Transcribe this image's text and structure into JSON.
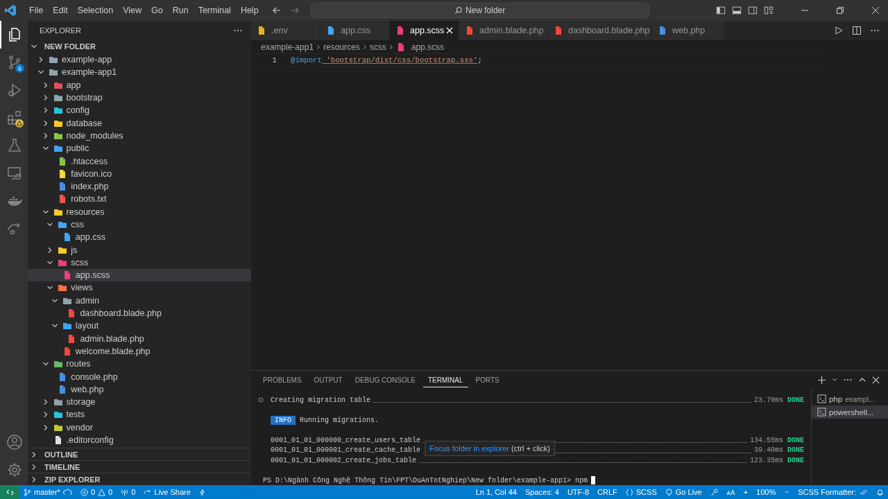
{
  "title_bar": {
    "menu": [
      "File",
      "Edit",
      "Selection",
      "View",
      "Go",
      "Run",
      "Terminal",
      "Help"
    ],
    "command_center": {
      "title": "New folder"
    }
  },
  "activity_bar": {
    "items": [
      {
        "kind": "explorer",
        "selected": true
      },
      {
        "kind": "source-control",
        "selected": false,
        "badge": "6"
      },
      {
        "kind": "run-debug",
        "selected": false
      },
      {
        "kind": "extensions",
        "selected": false,
        "warning": true
      },
      {
        "kind": "testing",
        "selected": false
      },
      {
        "kind": "remote",
        "selected": false
      },
      {
        "kind": "docker",
        "selected": false
      },
      {
        "kind": "live-share",
        "selected": false
      }
    ]
  },
  "sidebar": {
    "title": "EXPLORER",
    "root": "NEW FOLDER",
    "tree": [
      {
        "name": "example-app",
        "kind": "folder",
        "expanded": false,
        "selected": false,
        "color": "#90a4ae"
      },
      {
        "name": "example-app1",
        "kind": "folder",
        "expanded": true,
        "selected": false,
        "color": "#90a4ae",
        "children": [
          {
            "name": "app",
            "kind": "folder",
            "expanded": false,
            "selected": false,
            "color": "#e0505a"
          },
          {
            "name": "bootstrap",
            "kind": "folder",
            "expanded": false,
            "selected": false,
            "color": "#90a4ae"
          },
          {
            "name": "config",
            "kind": "folder",
            "expanded": false,
            "selected": false,
            "color": "#26c6da"
          },
          {
            "name": "database",
            "kind": "folder",
            "expanded": false,
            "selected": false,
            "color": "#ffca28"
          },
          {
            "name": "node_modules",
            "kind": "folder",
            "expanded": false,
            "selected": false,
            "color": "#8bc34a"
          },
          {
            "name": "public",
            "kind": "folder",
            "expanded": true,
            "selected": false,
            "color": "#42a5f5",
            "children": [
              {
                "name": ".htaccess",
                "kind": "file",
                "selected": false,
                "color": "#8bc34a"
              },
              {
                "name": "favicon.ico",
                "kind": "file",
                "selected": false,
                "color": "#ffd740"
              },
              {
                "name": "index.php",
                "kind": "file",
                "selected": false,
                "color": "#4a8fe0"
              },
              {
                "name": "robots.txt",
                "kind": "file",
                "selected": false,
                "color": "#ef5350"
              }
            ]
          },
          {
            "name": "resources",
            "kind": "folder",
            "expanded": true,
            "selected": false,
            "color": "#ffca28",
            "children": [
              {
                "name": "css",
                "kind": "folder",
                "expanded": true,
                "selected": false,
                "color": "#42a5f5",
                "children": [
                  {
                    "name": "app.css",
                    "kind": "file",
                    "selected": false,
                    "color": "#42a5f5"
                  }
                ]
              },
              {
                "name": "js",
                "kind": "folder",
                "expanded": false,
                "selected": false,
                "color": "#ffca28"
              },
              {
                "name": "scss",
                "kind": "folder",
                "expanded": true,
                "selected": false,
                "color": "#ec407a",
                "children": [
                  {
                    "name": "app.scss",
                    "kind": "file",
                    "selected": true,
                    "color": "#ec407a"
                  }
                ]
              },
              {
                "name": "views",
                "kind": "folder",
                "expanded": true,
                "selected": false,
                "color": "#ff7043",
                "children": [
                  {
                    "name": "admin",
                    "kind": "folder",
                    "expanded": true,
                    "selected": false,
                    "color": "#90a4ae",
                    "children": [
                      {
                        "name": "dashboard.blade.php",
                        "kind": "file",
                        "selected": false,
                        "color": "#f4473d"
                      }
                    ]
                  },
                  {
                    "name": "layout",
                    "kind": "folder",
                    "expanded": true,
                    "selected": false,
                    "color": "#42a5f5",
                    "children": [
                      {
                        "name": "admin.blade.php",
                        "kind": "file",
                        "selected": false,
                        "color": "#f4473d"
                      }
                    ]
                  },
                  {
                    "name": "welcome.blade.php",
                    "kind": "file",
                    "selected": false,
                    "color": "#f4473d"
                  }
                ]
              }
            ]
          },
          {
            "name": "routes",
            "kind": "folder",
            "expanded": true,
            "selected": false,
            "color": "#66bb6a",
            "children": [
              {
                "name": "console.php",
                "kind": "file",
                "selected": false,
                "color": "#4a8fe0"
              },
              {
                "name": "web.php",
                "kind": "file",
                "selected": false,
                "color": "#4a8fe0"
              }
            ]
          },
          {
            "name": "storage",
            "kind": "folder",
            "expanded": false,
            "selected": false,
            "color": "#90a4ae"
          },
          {
            "name": "tests",
            "kind": "folder",
            "expanded": false,
            "selected": false,
            "color": "#26c6da"
          },
          {
            "name": "vendor",
            "kind": "folder",
            "expanded": false,
            "selected": false,
            "color": "#c0ca33"
          },
          {
            "name": ".editorconfig",
            "kind": "file",
            "selected": false,
            "color": "#e0e0e0"
          }
        ]
      }
    ],
    "sections": [
      "OUTLINE",
      "TIMELINE",
      "ZIP EXPLORER"
    ]
  },
  "tabs": [
    {
      "label": ".env",
      "selected": false,
      "color": "#e6b422"
    },
    {
      "label": "app.css",
      "selected": false,
      "color": "#42a5f5"
    },
    {
      "label": "app.scss",
      "selected": true,
      "color": "#ec407a"
    },
    {
      "label": "admin.blade.php",
      "selected": false,
      "color": "#f4473d"
    },
    {
      "label": "dashboard.blade.php",
      "selected": false,
      "color": "#f4473d"
    },
    {
      "label": "web.php",
      "selected": false,
      "color": "#4a8fe0"
    }
  ],
  "breadcrumb": [
    "example-app1",
    "resources",
    "scss",
    "app.scss"
  ],
  "code": [
    {
      "line_number": "1",
      "tokens": [
        {
          "kind": "keyword",
          "text": "@import"
        },
        {
          "kind": "string",
          "text": " 'bootstrap/dist/css/bootstrap.sss'"
        },
        {
          "kind": "punctuation",
          "text": ";"
        }
      ]
    }
  ],
  "panel": {
    "tabs": [
      {
        "label": "PROBLEMS",
        "selected": false
      },
      {
        "label": "OUTPUT",
        "selected": false
      },
      {
        "label": "DEBUG CONSOLE",
        "selected": false
      },
      {
        "label": "TERMINAL",
        "selected": true
      },
      {
        "label": "PORTS",
        "selected": false
      }
    ],
    "terminal": [
      {
        "kind": "task",
        "text": "Creating migration table",
        "time": "23.70ms",
        "status": "DONE"
      },
      {
        "kind": "info",
        "badge": "INFO",
        "text": "Running migrations."
      },
      {
        "kind": "task",
        "text": "0001_01_01_000000_create_users_table",
        "time": "134.55ms",
        "status": "DONE"
      },
      {
        "kind": "task",
        "text": "0001_01_01_000001_create_cache_table",
        "time": "39.40ms",
        "status": "DONE"
      },
      {
        "kind": "task",
        "text": "0001_01_01_000002_create_jobs_table",
        "time": "123.35ms",
        "status": "DONE"
      },
      {
        "kind": "prompt",
        "text": "PS D:\\Ngành Công Nghệ Thông Tin\\FPT\\DuAnTotNghiep\\New folder\\example-app1> npm"
      }
    ],
    "tooltip": {
      "link": "Focus folder in explorer",
      "hint": "(ctrl + click)"
    },
    "terminals": [
      {
        "name": "php",
        "detail": "exampl...",
        "selected": false
      },
      {
        "name": "powershell...",
        "selected": true
      }
    ]
  },
  "status_bar": {
    "branch": "master*",
    "errors": "0",
    "warnings": "0",
    "ports": "0",
    "live_share": "Live Share",
    "position": "Ln 1, Col 44",
    "indent": "Spaces: 4",
    "encoding": "UTF-8",
    "eol": "CRLF",
    "language": "SCSS",
    "go_live": "Go Live",
    "zoom_in": "+",
    "zoom": "100%",
    "formatter": "SCSS Formatter:"
  }
}
